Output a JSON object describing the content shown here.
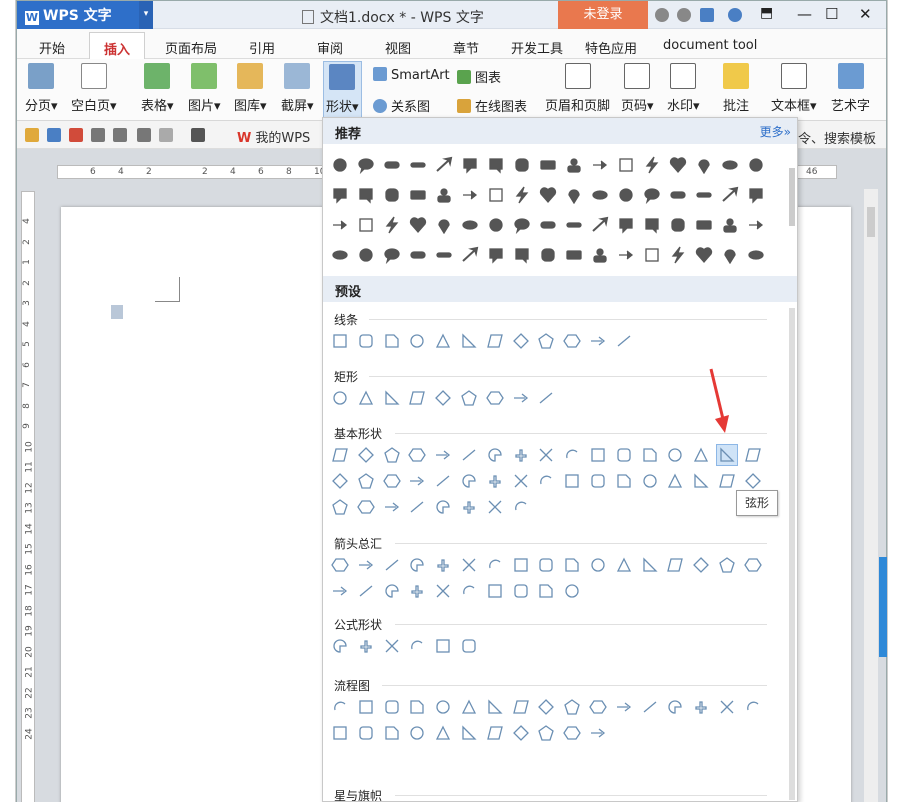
{
  "titlebar": {
    "app_name": "WPS 文字",
    "app_logo": "W",
    "doc_title": "文档1.docx * - WPS 文字",
    "login_label": "未登录"
  },
  "menubar": {
    "tabs": [
      "开始",
      "插入",
      "页面布局",
      "引用",
      "审阅",
      "视图",
      "章节",
      "开发工具",
      "特色应用",
      "document tool"
    ],
    "active": "插入"
  },
  "ribbon": {
    "page_break": "分页",
    "blank_page": "空白页",
    "table": "表格",
    "picture": "图片",
    "gallery": "图库",
    "screenshot": "截屏",
    "shapes": "形状",
    "smartart": "SmartArt",
    "chart": "图表",
    "relation": "关系图",
    "online_chart": "在线图表",
    "header_footer": "页眉和页脚",
    "page_number": "页码",
    "watermark": "水印",
    "comment": "批注",
    "textbox": "文本框",
    "wordart": "艺术字",
    "right_cut": "表"
  },
  "quickbar": {
    "my_wps": "我的WPS",
    "search_template": "令、搜索模板"
  },
  "rulers": {
    "h_ticks": [
      "6",
      "4",
      "2",
      "2",
      "4",
      "6",
      "8",
      "10",
      "46"
    ],
    "v_ticks": [
      "4",
      "2",
      "1",
      "2",
      "3",
      "4",
      "5",
      "6",
      "7",
      "8",
      "9",
      "10",
      "11",
      "12",
      "13",
      "14",
      "15",
      "16",
      "17",
      "18",
      "19",
      "20",
      "21",
      "22",
      "23",
      "24"
    ]
  },
  "panel": {
    "recommended": "推荐",
    "more": "更多»",
    "presets": "预设",
    "sections": [
      {
        "title": "线条",
        "count": 12
      },
      {
        "title": "矩形",
        "count": 9
      },
      {
        "title": "基本形状",
        "count": 42
      },
      {
        "title": "箭头总汇",
        "count": 27
      },
      {
        "title": "公式形状",
        "count": 6
      },
      {
        "title": "流程图",
        "count": 28
      },
      {
        "title": "星与旗帜",
        "count": 16
      }
    ],
    "highlighted_shape": "弦形",
    "tooltip": "弦形"
  },
  "colors": {
    "accent": "#2e6fc9",
    "login": "#e9784e",
    "shape_icon": "#6b8fb3",
    "recommended_icon": "#555555",
    "arrow": "#e53935"
  }
}
